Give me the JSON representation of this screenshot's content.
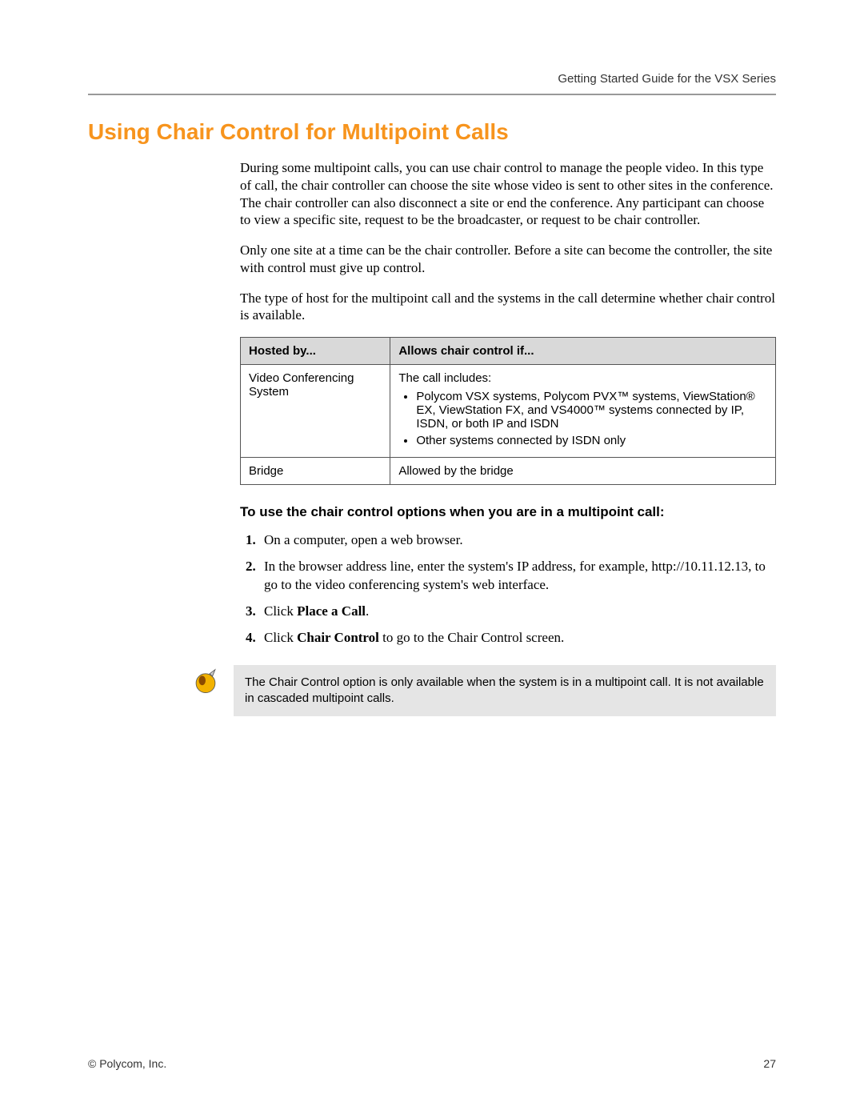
{
  "header": {
    "running_head": "Getting Started Guide for the VSX Series"
  },
  "title": "Using Chair Control for Multipoint Calls",
  "paragraphs": {
    "p1": "During some multipoint calls, you can use chair control to manage the people video. In this type of call, the chair controller can choose the site whose video is sent to other sites in the conference. The chair controller can also disconnect a site or end the conference. Any participant can choose to view a specific site, request to be the broadcaster, or request to be chair controller.",
    "p2": "Only one site at a time can be the chair controller. Before a site can become the controller, the site with control must give up control.",
    "p3": "The type of host for the multipoint call and the systems in the call determine whether chair control is available."
  },
  "table": {
    "headers": {
      "c1": "Hosted by...",
      "c2": "Allows chair control if..."
    },
    "row1": {
      "host": "Video Conferencing System",
      "lead": "The call includes:",
      "bullets": {
        "b1": "Polycom VSX systems, Polycom PVX™ systems, ViewStation® EX, ViewStation FX, and VS4000™ systems connected by IP, ISDN, or both IP and ISDN",
        "b2": "Other systems connected by ISDN only"
      }
    },
    "row2": {
      "host": "Bridge",
      "allow": "Allowed by the bridge"
    }
  },
  "subhead": "To use the chair control options when you are in a multipoint call:",
  "steps": {
    "s1": "On a computer, open a web browser.",
    "s2": "In the browser address line, enter the system's IP address, for example, http://10.11.12.13, to go to the video conferencing system's web interface.",
    "s3a": "Click ",
    "s3b": "Place a Call",
    "s3c": ".",
    "s4a": "Click ",
    "s4b": "Chair Control",
    "s4c": " to go to the Chair Control screen."
  },
  "note": "The Chair Control option is only available when the system is in a multipoint call. It is not available in cascaded multipoint calls.",
  "footer": {
    "left": "© Polycom, Inc.",
    "right": "27"
  }
}
